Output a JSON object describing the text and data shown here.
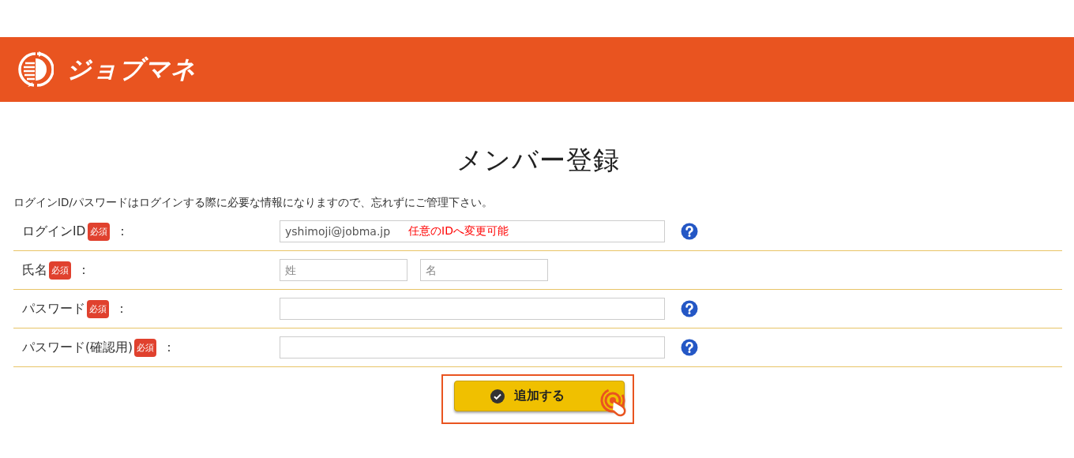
{
  "header": {
    "logo_text": "ジョブマネ"
  },
  "title": "メンバー登録",
  "note": "ログインID/パスワードはログインする際に必要な情報になりますので、忘れずにご管理下さい。",
  "rows": [
    {
      "kind": "text",
      "label": "ログインID",
      "badge": "必須",
      "colon": "：",
      "value": "yshimoji@jobma.jp",
      "annotation": "任意のIDへ変更可能",
      "help": true
    },
    {
      "kind": "name",
      "label": "氏名",
      "badge": "必須",
      "colon": "：",
      "placeholders": [
        "姓",
        "名"
      ],
      "help": false
    },
    {
      "kind": "password",
      "label": "パスワード",
      "badge": "必須",
      "colon": "：",
      "help": true
    },
    {
      "kind": "password",
      "label": "パスワード(確認用)",
      "badge": "必須",
      "colon": "：",
      "help": true
    }
  ],
  "submit": {
    "label": "追加する",
    "highlighted": true
  }
}
